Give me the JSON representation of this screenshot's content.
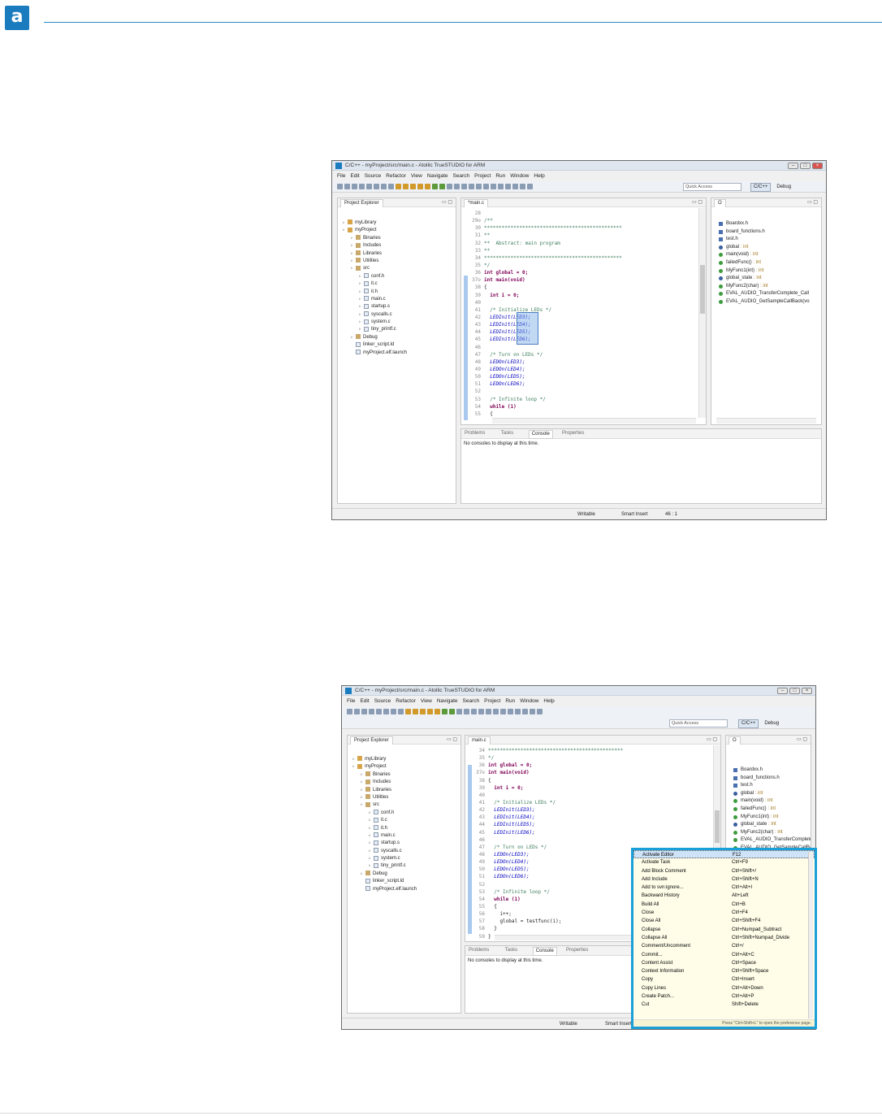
{
  "brand": {
    "logo_letter": "a",
    "accent": "#1a7bbf",
    "rule_color": "#2a8cc4"
  },
  "ide": {
    "title": "C/C++ - myProject/src/main.c - Atollic TrueSTUDIO for ARM",
    "menu": [
      "File",
      "Edit",
      "Source",
      "Refactor",
      "View",
      "Navigate",
      "Search",
      "Project",
      "Run",
      "Window",
      "Help"
    ],
    "quick_access_placeholder": "Quick Access",
    "perspectives": {
      "active": "C/C++",
      "other": "Debug"
    },
    "project_explorer": {
      "tab": "Project Explorer",
      "items": [
        {
          "label": "myLibrary",
          "level": 0,
          "type": "proj"
        },
        {
          "label": "myProject",
          "level": 0,
          "type": "proj"
        },
        {
          "label": "Binaries",
          "level": 1,
          "type": "folder"
        },
        {
          "label": "Includes",
          "level": 1,
          "type": "folder"
        },
        {
          "label": "Libraries",
          "level": 1,
          "type": "folder"
        },
        {
          "label": "Utilities",
          "level": 1,
          "type": "folder"
        },
        {
          "label": "src",
          "level": 1,
          "type": "folder"
        },
        {
          "label": "conf.h",
          "level": 2,
          "type": "file"
        },
        {
          "label": "it.c",
          "level": 2,
          "type": "file"
        },
        {
          "label": "it.h",
          "level": 2,
          "type": "file"
        },
        {
          "label": "main.c",
          "level": 2,
          "type": "file"
        },
        {
          "label": "startup.s",
          "level": 2,
          "type": "file"
        },
        {
          "label": "syscalls.c",
          "level": 2,
          "type": "file"
        },
        {
          "label": "system.c",
          "level": 2,
          "type": "file"
        },
        {
          "label": "tiny_printf.c",
          "level": 2,
          "type": "file"
        },
        {
          "label": "Debug",
          "level": 1,
          "type": "folder"
        },
        {
          "label": "linker_script.ld",
          "level": 1,
          "type": "file"
        },
        {
          "label": "myProject.elf.launch",
          "level": 1,
          "type": "file"
        }
      ]
    },
    "outline": {
      "items": [
        {
          "name": "Boardxx.h",
          "type": "",
          "kind": "h"
        },
        {
          "name": "board_functions.h",
          "type": "",
          "kind": "h"
        },
        {
          "name": "test.h",
          "type": "",
          "kind": "h"
        },
        {
          "name": "global",
          "type": " : int",
          "kind": "b"
        },
        {
          "name": "main(void)",
          "type": " : int",
          "kind": "g"
        },
        {
          "name": "failedFunc()",
          "type": " : int",
          "kind": "g"
        },
        {
          "name": "MyFunc1(int)",
          "type": " : int",
          "kind": "g"
        },
        {
          "name": "global_state",
          "type": " : int",
          "kind": "b"
        },
        {
          "name": "MyFunc2(char)",
          "type": " : int",
          "kind": "g"
        },
        {
          "name": "EVAL_AUDIO_TransferComplete_Call",
          "type": "",
          "kind": "g"
        },
        {
          "name": "EVAL_AUDIO_GetSampleCallBack(vo",
          "type": "",
          "kind": "g"
        }
      ]
    },
    "console": {
      "tabs": [
        "Problems",
        "Tasks",
        "Console",
        "Properties"
      ],
      "message": "No consoles to display at this time."
    },
    "status": {
      "writable": "Writable",
      "insert": "Smart Insert",
      "position": "46 : 1"
    }
  },
  "screenshot1": {
    "editor_tab": "*main.c",
    "lines": [
      {
        "n": "28",
        "t": "",
        "c": ""
      },
      {
        "n": "29⊖",
        "t": "/**",
        "c": "com"
      },
      {
        "n": "30",
        "t": "***********************************************",
        "c": "com"
      },
      {
        "n": "31",
        "t": "**",
        "c": "com"
      },
      {
        "n": "32",
        "t": "**  Abstract: main program",
        "c": "com"
      },
      {
        "n": "33",
        "t": "**",
        "c": "com"
      },
      {
        "n": "34",
        "t": "***********************************************",
        "c": "com"
      },
      {
        "n": "35",
        "t": "*/",
        "c": "com"
      },
      {
        "n": "36",
        "t": "int global = 0;",
        "c": "kw"
      },
      {
        "n": "37⊖",
        "t": "int main(void)",
        "c": "kw"
      },
      {
        "n": "38",
        "t": "{",
        "c": ""
      },
      {
        "n": "39",
        "t": "  int i = 0;",
        "c": "kw"
      },
      {
        "n": "40",
        "t": "",
        "c": ""
      },
      {
        "n": "41",
        "t": "  /* Initialize LEDs */",
        "c": "com"
      },
      {
        "n": "42",
        "t": "  LEDInit(LED3);",
        "c": "mac"
      },
      {
        "n": "43",
        "t": "  LEDInit(LED4);",
        "c": "mac"
      },
      {
        "n": "44",
        "t": "  LEDInit(LED5);",
        "c": "mac"
      },
      {
        "n": "45",
        "t": "  LEDInit(LED6);",
        "c": "mac"
      },
      {
        "n": "46",
        "t": "",
        "c": ""
      },
      {
        "n": "47",
        "t": "  /* Turn on LEDs */",
        "c": "com"
      },
      {
        "n": "48",
        "t": "  LEDOn(LED3);",
        "c": "mac"
      },
      {
        "n": "49",
        "t": "  LEDOn(LED4);",
        "c": "mac"
      },
      {
        "n": "50",
        "t": "  LEDOn(LED5);",
        "c": "mac"
      },
      {
        "n": "51",
        "t": "  LEDOn(LED6);",
        "c": "mac"
      },
      {
        "n": "52",
        "t": "",
        "c": ""
      },
      {
        "n": "53",
        "t": "  /* Infinite loop */",
        "c": "com"
      },
      {
        "n": "54",
        "t": "  while (1)",
        "c": "kw"
      },
      {
        "n": "55",
        "t": "  {",
        "c": ""
      }
    ]
  },
  "screenshot2": {
    "editor_tab": "main.c",
    "lines": [
      {
        "n": "34",
        "t": "**********************************************",
        "c": "com"
      },
      {
        "n": "35",
        "t": "*/",
        "c": "com"
      },
      {
        "n": "36",
        "t": "int global = 0;",
        "c": "kw"
      },
      {
        "n": "37⊖",
        "t": "int main(void)",
        "c": "kw"
      },
      {
        "n": "38",
        "t": "{",
        "c": ""
      },
      {
        "n": "39",
        "t": "  int i = 0;",
        "c": "kw"
      },
      {
        "n": "40",
        "t": "",
        "c": ""
      },
      {
        "n": "41",
        "t": "  /* Initialize LEDs */",
        "c": "com"
      },
      {
        "n": "42",
        "t": "  LEDInit(LED3);",
        "c": "mac"
      },
      {
        "n": "43",
        "t": "  LEDInit(LED4);",
        "c": "mac"
      },
      {
        "n": "44",
        "t": "  LEDInit(LED5);",
        "c": "mac"
      },
      {
        "n": "45",
        "t": "  LEDInit(LED6);",
        "c": "mac"
      },
      {
        "n": "46",
        "t": "",
        "c": ""
      },
      {
        "n": "47",
        "t": "  /* Turn on LEDs */",
        "c": "com"
      },
      {
        "n": "48",
        "t": "  LEDOn(LED3);",
        "c": "mac"
      },
      {
        "n": "49",
        "t": "  LEDOn(LED4);",
        "c": "mac"
      },
      {
        "n": "50",
        "t": "  LEDOn(LED5);",
        "c": "mac"
      },
      {
        "n": "51",
        "t": "  LEDOn(LED6);",
        "c": "mac"
      },
      {
        "n": "52",
        "t": "",
        "c": ""
      },
      {
        "n": "53",
        "t": "  /* Infinite loop */",
        "c": "com"
      },
      {
        "n": "54",
        "t": "  while (1)",
        "c": "kw"
      },
      {
        "n": "55",
        "t": "  {",
        "c": ""
      },
      {
        "n": "56",
        "t": "    i++;",
        "c": ""
      },
      {
        "n": "57",
        "t": "    global = testfunc(i);",
        "c": ""
      },
      {
        "n": "58",
        "t": "  }",
        "c": ""
      },
      {
        "n": "59",
        "t": "}",
        "c": ""
      },
      {
        "n": "60",
        "t": "",
        "c": ""
      },
      {
        "n": "61",
        "t": "",
        "c": ""
      }
    ],
    "key_assist": {
      "rows": [
        {
          "cmd": "Activate Editor",
          "key": "F12"
        },
        {
          "cmd": "Activate Task",
          "key": "Ctrl+F9"
        },
        {
          "cmd": "Add Block Comment",
          "key": "Ctrl+Shift+/"
        },
        {
          "cmd": "Add Include",
          "key": "Ctrl+Shift+N"
        },
        {
          "cmd": "Add to svn:ignore...",
          "key": "Ctrl+Alt+I"
        },
        {
          "cmd": "Backward History",
          "key": "Alt+Left"
        },
        {
          "cmd": "Build All",
          "key": "Ctrl+B"
        },
        {
          "cmd": "Close",
          "key": "Ctrl+F4"
        },
        {
          "cmd": "Close All",
          "key": "Ctrl+Shift+F4"
        },
        {
          "cmd": "Collapse",
          "key": "Ctrl+Numpad_Subtract"
        },
        {
          "cmd": "Collapse All",
          "key": "Ctrl+Shift+Numpad_Divide"
        },
        {
          "cmd": "Comment/Uncomment",
          "key": "Ctrl+/"
        },
        {
          "cmd": "Commit...",
          "key": "Ctrl+Alt+C"
        },
        {
          "cmd": "Content Assist",
          "key": "Ctrl+Space"
        },
        {
          "cmd": "Context Information",
          "key": "Ctrl+Shift+Space"
        },
        {
          "cmd": "Copy",
          "key": "Ctrl+Insert"
        },
        {
          "cmd": "Copy Lines",
          "key": "Ctrl+Alt+Down"
        },
        {
          "cmd": "Create Patch...",
          "key": "Ctrl+Alt+P"
        },
        {
          "cmd": "Cut",
          "key": "Shift+Delete"
        }
      ],
      "hint": "Press \"Ctrl+Shift+L\" to open the preference page."
    }
  }
}
